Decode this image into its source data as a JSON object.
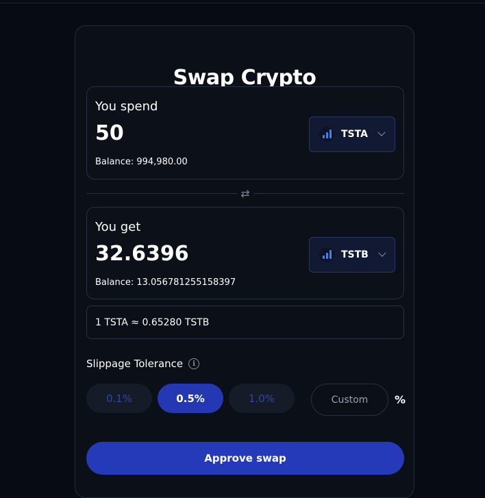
{
  "title": "Swap Crypto",
  "spend": {
    "label": "You spend",
    "amount": "50",
    "balance": "Balance: 994,980.00",
    "token": "TSTA"
  },
  "get": {
    "label": "You get",
    "amount": "32.6396",
    "balance": "Balance: 13.056781255158397",
    "token": "TSTB"
  },
  "rate": "1 TSTA ≈ 0.65280 TSTB",
  "slippage": {
    "label": "Slippage Tolerance",
    "options": [
      "0.1%",
      "0.5%",
      "1.0%"
    ],
    "selected": "0.5%",
    "custom_placeholder": "Custom",
    "unit": "%"
  },
  "approve_label": "Approve swap",
  "icons": {
    "swap_direction": "swap-arrows-icon",
    "info": "info-icon",
    "chevron": "chevron-down-icon",
    "token": "token-logo-icon"
  },
  "colors": {
    "accent": "#253ab8",
    "token_bar": "#3b82f6"
  }
}
